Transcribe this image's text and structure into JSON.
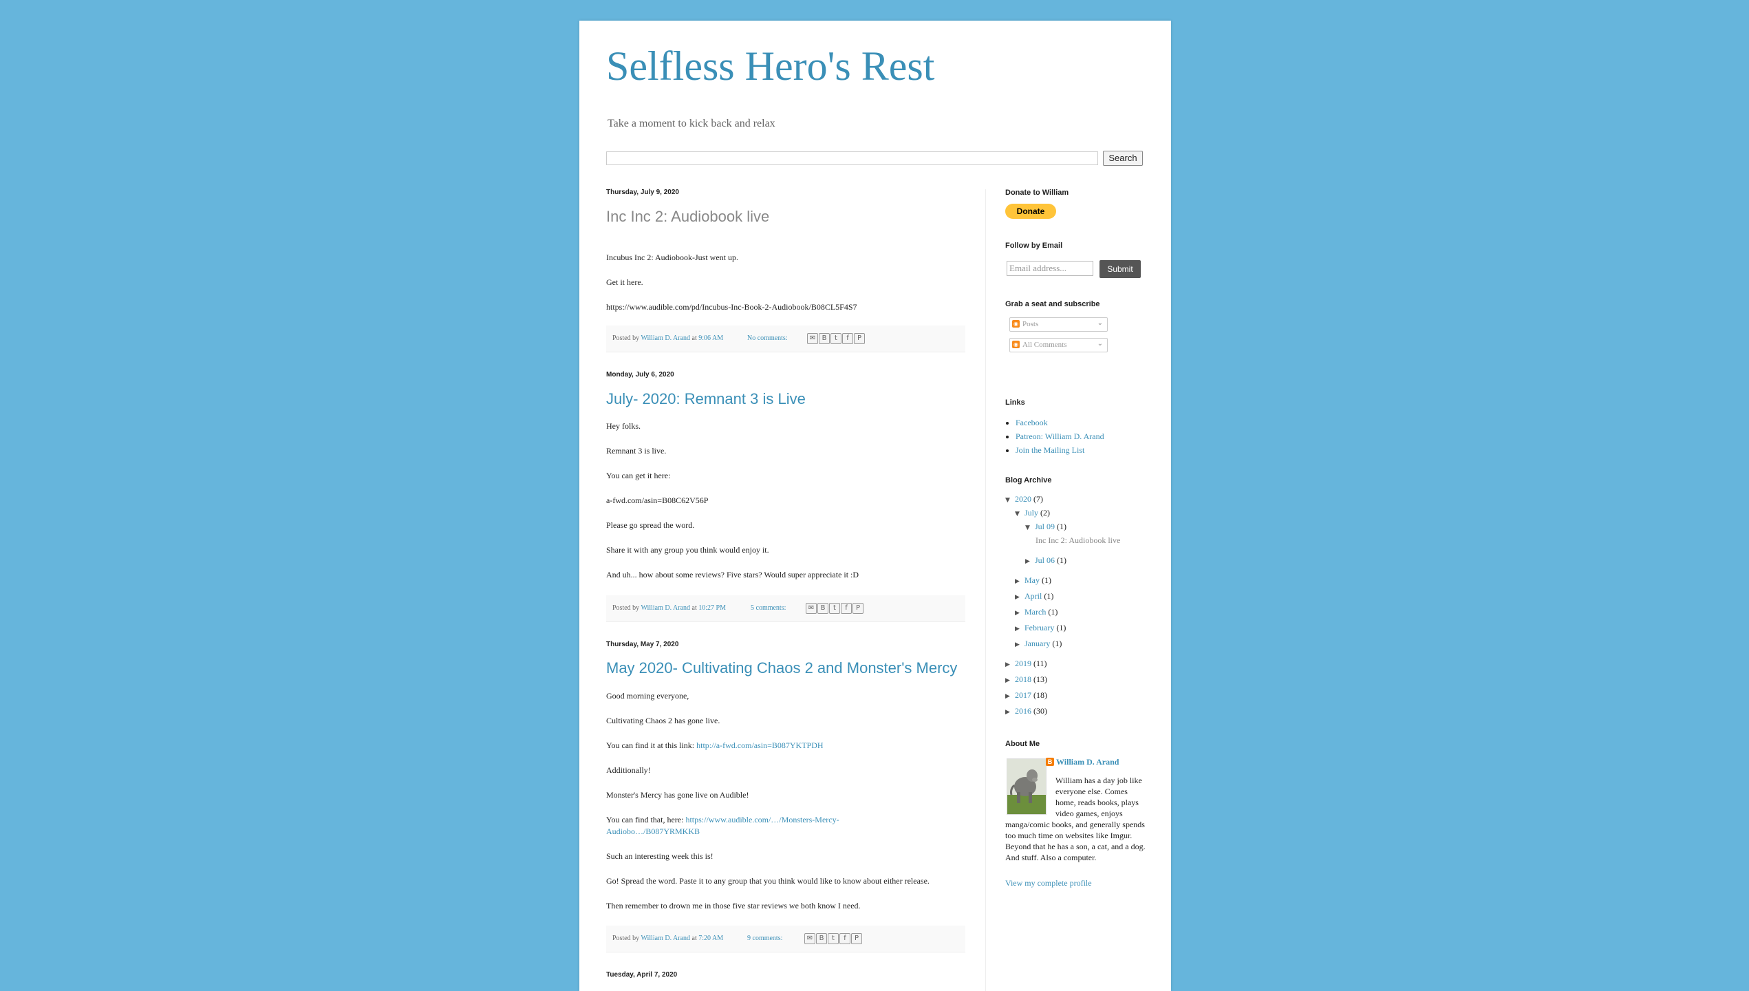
{
  "header": {
    "title": "Selfless Hero's Rest",
    "description": "Take a moment to kick back and relax",
    "search_button": "Search"
  },
  "posts": [
    {
      "date": "Thursday, July 9, 2020",
      "title": "Inc Inc 2: Audiobook live",
      "paragraphs": [
        "Incubus Inc 2: Audiobook-Just went up.",
        "Get it here.",
        "https://www.audible.com/pd/Incubus-Inc-Book-2-Audiobook/B08CL5F4S7"
      ],
      "posted_by": "Posted by",
      "author": "William D. Arand",
      "at": "at",
      "time": "9:06 AM",
      "comments": "No comments:"
    },
    {
      "date": "Monday, July 6, 2020",
      "title": "July- 2020: Remnant 3 is Live",
      "paragraphs": [
        "Hey folks.",
        "Remnant 3 is live.",
        "You can get it here:",
        "a-fwd.com/asin=B08C62V56P",
        "Please go spread the word.",
        "Share it with any group you think would enjoy it.",
        "And uh... how about some reviews? Five stars? Would super appreciate it :D"
      ],
      "posted_by": "Posted by",
      "author": "William D. Arand",
      "at": "at",
      "time": "10:27 PM",
      "comments": "5 comments:"
    },
    {
      "date": "Thursday, May 7, 2020",
      "title": "May 2020- Cultivating Chaos 2 and Monster's Mercy",
      "paragraphs": [
        "Good morning everyone,",
        "Cultivating Chaos 2 has gone live.",
        "You can find it at this link:",
        "http://a-fwd.com/asin=B087YKTPDH",
        "Additionally!",
        "Monster's Mercy has gone live on Audible!",
        "You can find that, here:",
        "https://www.audible.com/…/Monsters-Mercy-",
        "Audiobo…/B087YRMKKB",
        "Such an interesting week this is!",
        "Go! Spread the word. Paste it to any group that you think would like to know about either release.",
        "Then remember to drown me in those five star reviews we both know I need."
      ],
      "posted_by": "Posted by",
      "author": "William D. Arand",
      "at": "at",
      "time": "7:20 AM",
      "comments": "9 comments:"
    },
    {
      "date": "Tuesday, April 7, 2020"
    }
  ],
  "share_icons": [
    "email-icon",
    "blogthis-icon",
    "twitter-icon",
    "facebook-icon",
    "pinterest-icon"
  ],
  "sidebar": {
    "donate_heading": "Donate to William",
    "donate_button": "Donate",
    "follow_heading": "Follow by Email",
    "email_placeholder": "Email address...",
    "submit_button": "Submit",
    "subscribe_heading": "Grab a seat and subscribe",
    "feeds": [
      "Posts",
      "All Comments"
    ],
    "links_heading": "Links",
    "links": [
      "Facebook",
      "Patreon: William D. Arand",
      "Join the Mailing List"
    ],
    "archive_heading": "Blog Archive",
    "archive": {
      "y2020": "2020",
      "y2020_count": "(7)",
      "july": "July",
      "july_count": "(2)",
      "jul09": "Jul 09",
      "jul09_count": "(1)",
      "jul09_post": "Inc Inc 2: Audiobook live",
      "jul06": "Jul 06",
      "jul06_count": "(1)",
      "may": "May",
      "may_count": "(1)",
      "april": "April",
      "april_count": "(1)",
      "march": "March",
      "march_count": "(1)",
      "february": "February",
      "february_count": "(1)",
      "january": "January",
      "january_count": "(1)",
      "y2019": "2019",
      "y2019_count": "(11)",
      "y2018": "2018",
      "y2018_count": "(13)",
      "y2017": "2017",
      "y2017_count": "(18)",
      "y2016": "2016",
      "y2016_count": "(30)"
    },
    "about_heading": "About Me",
    "profile_name": "William D. Arand",
    "about_text": "William has a day job like everyone else. Comes home, reads books, plays video games, enjoys manga/comic books, and generally spends too much time on websites like Imgur. Beyond that he has a son, a cat, and a dog. And stuff. Also a computer.",
    "profile_link": "View my complete profile"
  },
  "colors": {
    "background": "#66b5dc",
    "link": "#3a8fb7",
    "donate": "#ffc439"
  }
}
